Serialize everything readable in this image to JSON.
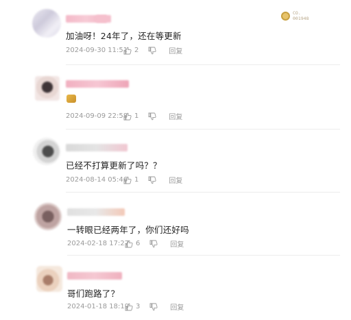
{
  "comments": [
    {
      "text": "加油呀！24年了，还在等更新",
      "date": "2024-09-30 11:51",
      "likes": "2",
      "reply": "回复"
    },
    {
      "text": "",
      "date": "2024-09-09 22:58",
      "likes": "1",
      "reply": "回复"
    },
    {
      "text": "已经不打算更新了吗？？",
      "date": "2024-08-14 05:46",
      "likes": "1",
      "reply": "回复"
    },
    {
      "text": "一转眼已经两年了，你们还好吗",
      "date": "2024-02-18 17:27",
      "likes": "6",
      "reply": "回复"
    },
    {
      "text": "哥们跑路了？",
      "date": "2024-01-18 18:19",
      "likes": "3",
      "reply": "回复"
    }
  ],
  "badge": {
    "line1": "CO.",
    "line2": "001948"
  },
  "colors": {
    "meta": "#9a9a9a",
    "divider": "#ececec",
    "text": "#222222"
  }
}
